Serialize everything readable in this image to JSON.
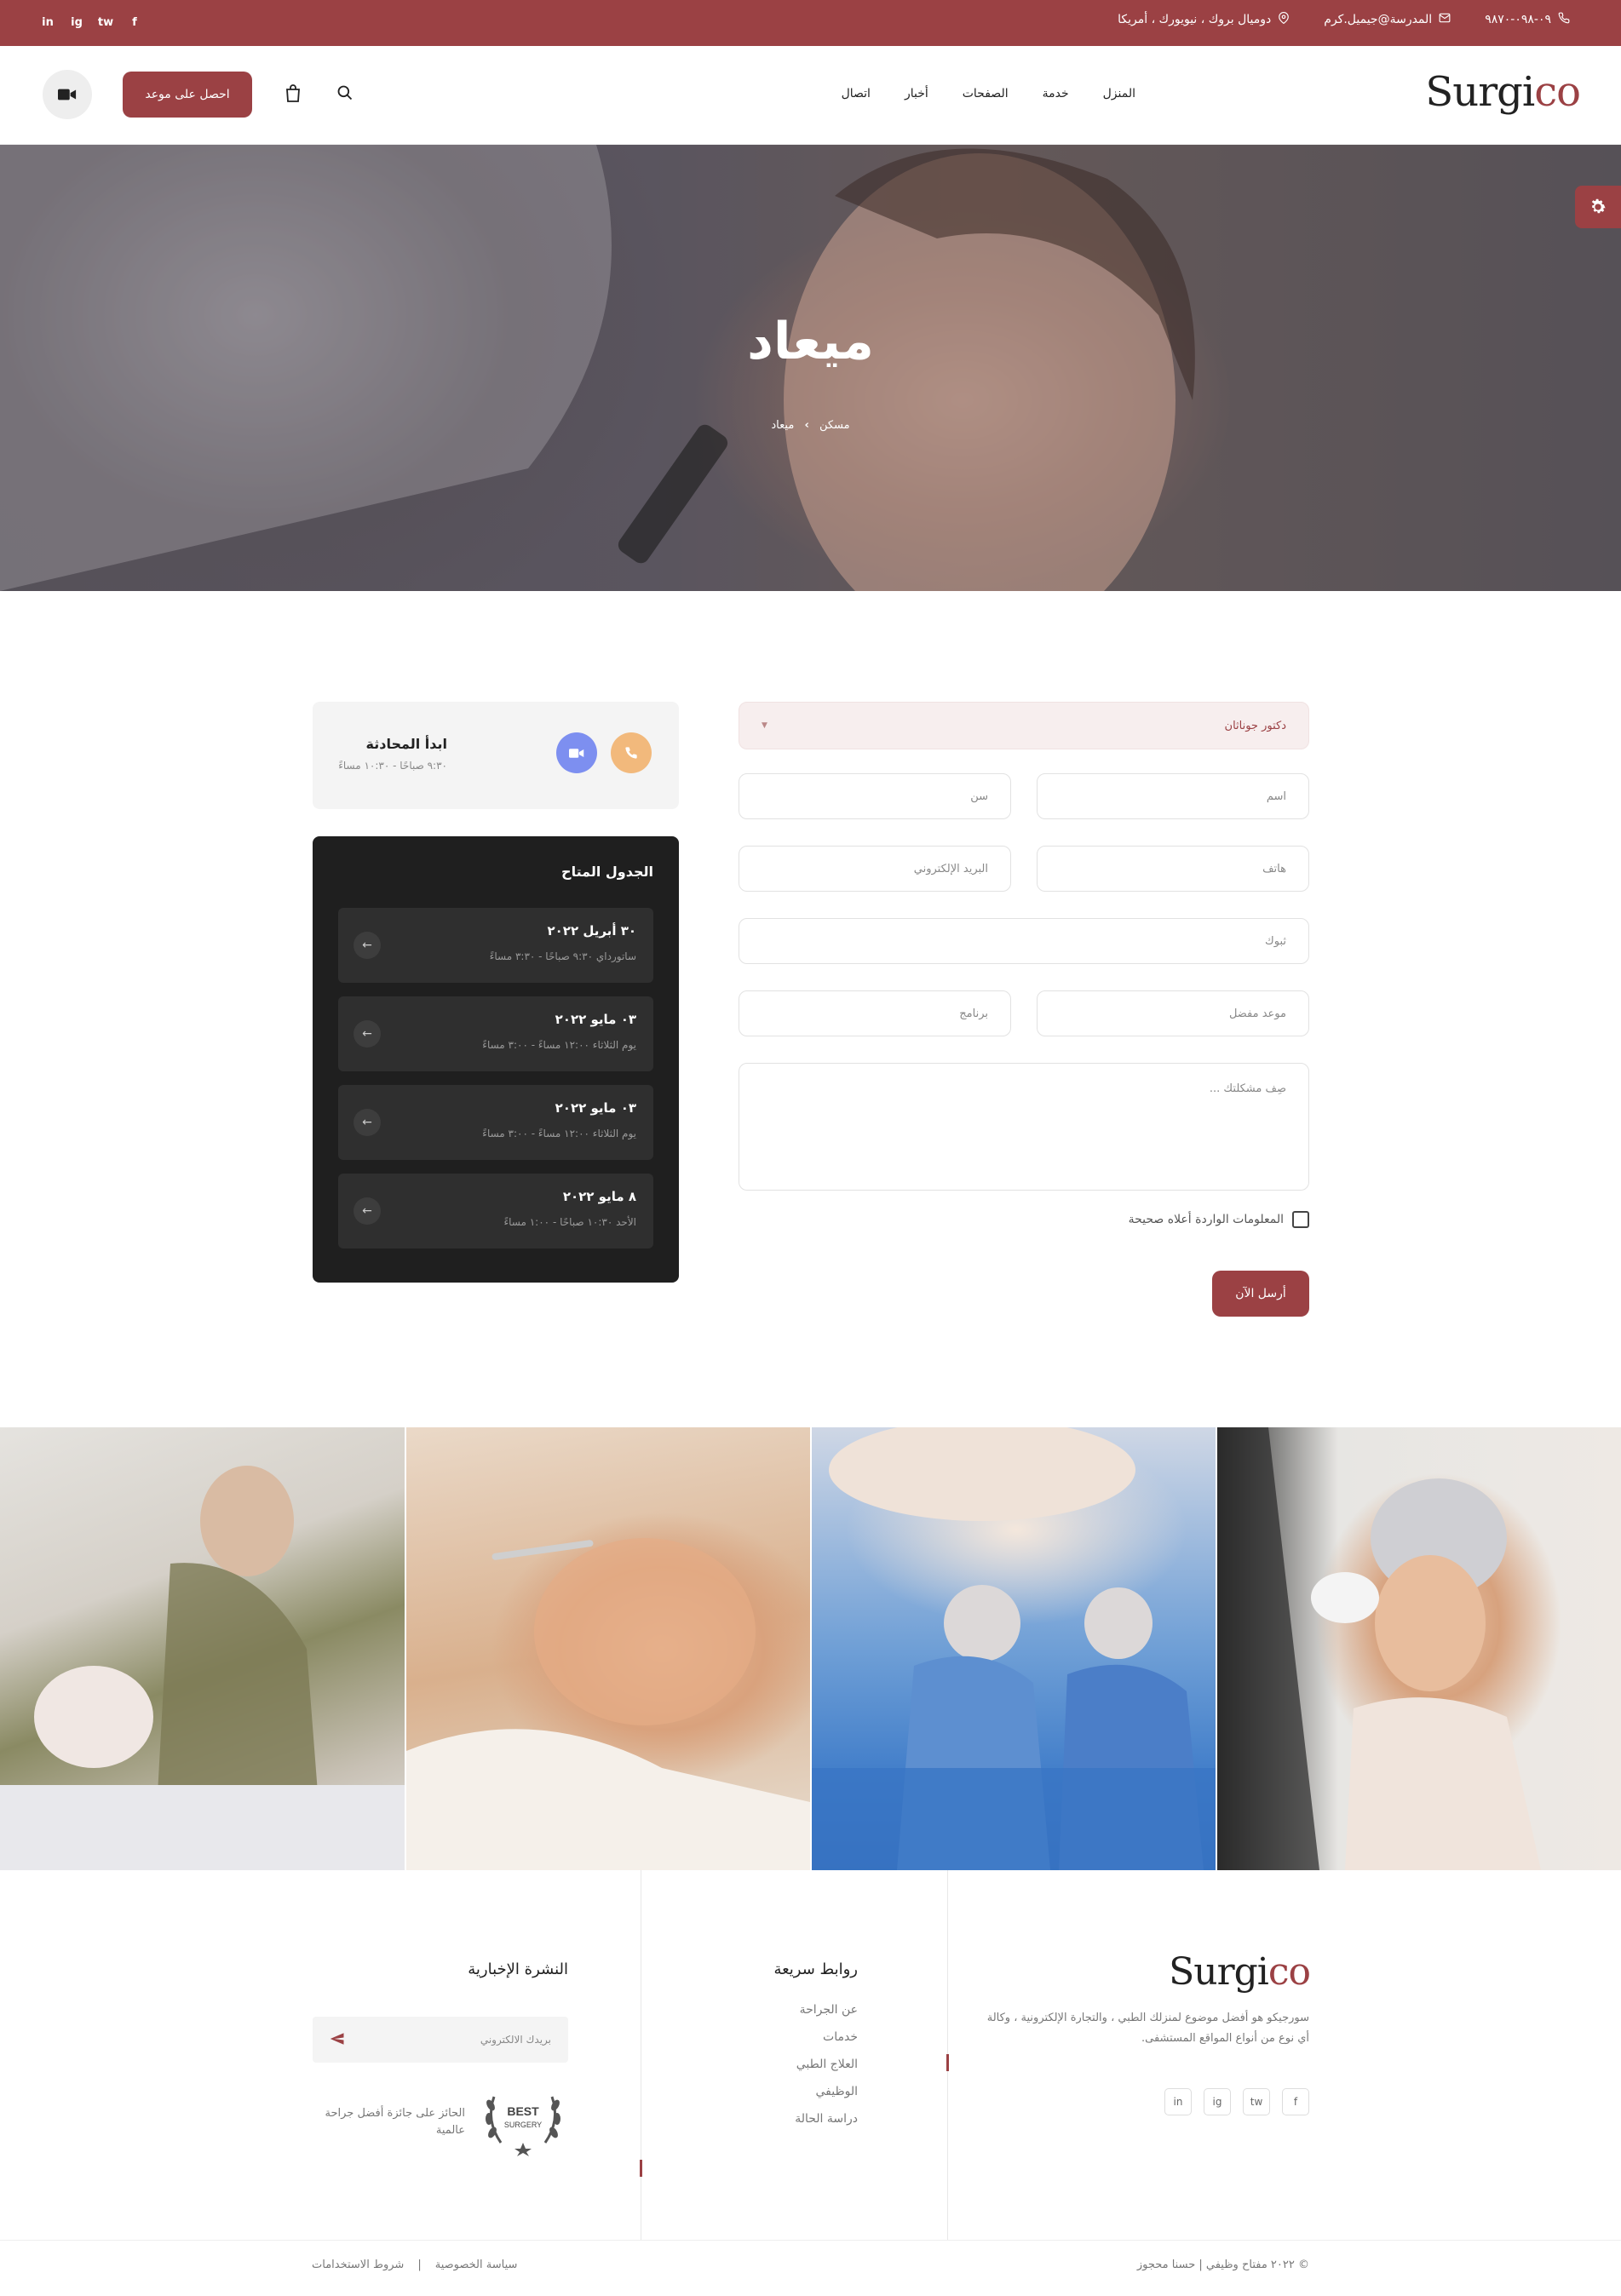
{
  "topbar": {
    "phone": "٠٩-٠٩٨-٩٨٧٠",
    "email": "المدرسة@جيميل.كرم",
    "address": "دوميال بروك ، نيويورك ، أمريكا",
    "social": [
      "in",
      "ig",
      "tw",
      "f"
    ]
  },
  "header": {
    "logo_main": "Surgi",
    "logo_accent": "co",
    "nav": [
      "المنزل",
      "خدمة",
      "الصفحات",
      "أخبار",
      "اتصال"
    ],
    "cta": "احصل على موعد"
  },
  "hero": {
    "title": "ميعاد",
    "breadcrumb_home": "مسكن",
    "breadcrumb_sep": "›",
    "breadcrumb_current": "ميعاد"
  },
  "form": {
    "doctor": "دكتور جوناثان",
    "name_placeholder": "اسم",
    "age_placeholder": "سن",
    "phone_placeholder": "هاتف",
    "email_placeholder": "البريد الإلكتروني",
    "title_placeholder": "ثبوك",
    "preferred_placeholder": "موعد مفضل",
    "program_placeholder": "برنامج",
    "problem_placeholder": "صِف مشكلتك ...",
    "checkbox_label": "المعلومات الواردة أعلاه صحيحة",
    "submit": "أرسل الآن"
  },
  "chat": {
    "title": "ابدأ المحادثة",
    "hours": "٩:٣٠ صباحًا - ١٠:٣٠ مساءً"
  },
  "schedule": {
    "title": "الجدول المتاح",
    "slots": [
      {
        "date": "٣٠ أبريل ٢٠٢٢",
        "sub": "ساتورداي   ٩:٣٠ صباحًا - ٣:٣٠ مساءً"
      },
      {
        "date": "٠٣ مايو ٢٠٢٢",
        "sub": "يوم الثلاثاء   ١٢:٠٠ مساءً - ٣:٠٠ مساءً"
      },
      {
        "date": "٠٣ مايو ٢٠٢٢",
        "sub": "يوم الثلاثاء   ١٢:٠٠ مساءً - ٣:٠٠ مساءً"
      },
      {
        "date": "٨ مايو ٢٠٢٢",
        "sub": "الأحد   ١٠:٣٠ صباحًا - ١:٠٠ مساءً"
      }
    ]
  },
  "footer": {
    "logo_main": "Surgi",
    "logo_accent": "co",
    "desc": "سورجيكو هو أفضل موضوع لمنزلك الطبي ، والتجارة الإلكترونية ، وكالة أي نوع من أنواع المواقع المستشفى.",
    "social": [
      "f",
      "tw",
      "ig",
      "in"
    ],
    "links_title": "روابط سريعة",
    "links": [
      "عن الجراحة",
      "خدمات",
      "العلاج الطبي",
      "الوظيفي",
      "دراسة الحالة"
    ],
    "news_title": "النشرة الإخبارية",
    "news_placeholder": "بريدك الالكتروني",
    "award_top": "BEST",
    "award_bottom": "SURGERY",
    "award_text": "الحائز على جائزة أفضل جراحة عالمية",
    "copyright": "© ٢٠٢٢ مفتاح وظيفي | حسنا محجوز",
    "privacy": "سياسة الخصوصية",
    "divider": "|",
    "terms": "شروط الاستخدامات"
  },
  "colors": {
    "accent": "#9b4144",
    "dark": "#1f1f1f"
  }
}
